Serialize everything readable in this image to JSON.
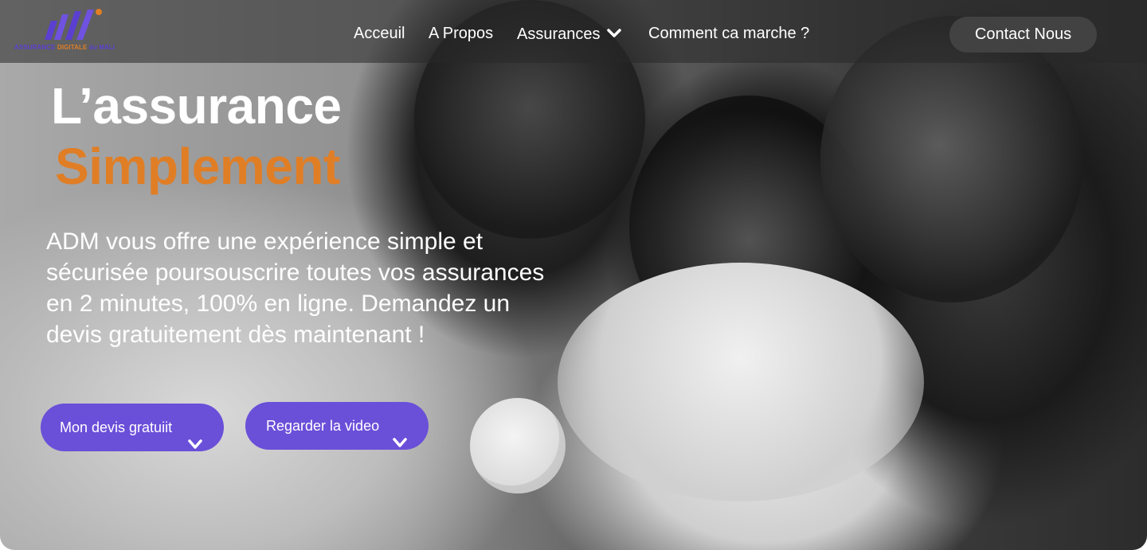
{
  "brand": {
    "caption_part1": "ASSURANCE ",
    "caption_part2": "DIGITALE",
    "caption_part3": " du MALI",
    "primary_color": "#5b3fd1",
    "accent_color": "#e07e26"
  },
  "nav": {
    "items": [
      {
        "label": "Acceuil"
      },
      {
        "label": "A Propos"
      },
      {
        "label": "Assurances",
        "icon": "chevron-down-icon"
      },
      {
        "label": "Comment ca marche ?"
      }
    ],
    "contact_label": "Contact Nous"
  },
  "hero": {
    "title": "L’assurance",
    "title_accent": "Simplement",
    "description": "ADM vous offre une expérience simple et sécurisée poursouscrire toutes vos assurances en 2 minutes, 100% en ligne. Demandez un devis gratuitement dès maintenant !",
    "cta_quote": "Mon devis gratuiit",
    "cta_video": "Regarder la video",
    "button_color": "#6a4fd9"
  }
}
